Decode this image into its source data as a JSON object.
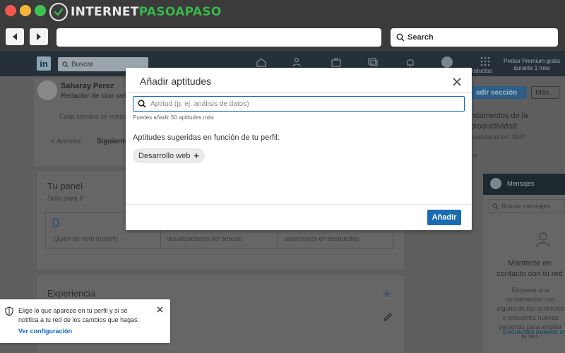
{
  "browser": {
    "brand_prefix": "INTERNET",
    "brand_accent": "PASOAPASO",
    "search_label": "Search"
  },
  "linkedin": {
    "search_placeholder": "Buscar",
    "premium_text": "Probar Premium gratis durante 1 mes",
    "products_label": "roductos",
    "profile": {
      "name": "Saharay Perez",
      "role": "Redactor de sitio web"
    },
    "background": {
      "weekly_text": "Cada semana se realiza",
      "prev_label": "< Anterior",
      "next_label": "Siguiente",
      "add_section_label": "adir sección",
      "more_label": "Más...",
      "article_title": "ndamentos de la productividad",
      "article_views": "sualizaciones: 9947",
      "article_more": "es",
      "panel_title": "Tu panel",
      "panel_subtitle": "Solo para ti",
      "panel_value": "0",
      "panel_stat_1": "Quién ha visto tu perfil",
      "panel_stat_2": "visualizaciones del artículo",
      "panel_stat_3": "apariciones en búsquedas",
      "experience_title": "Experiencia",
      "messages_title": "Mensajes",
      "messages_search": "Buscar mensajes",
      "network_title": "Mantente en contacto con tu red",
      "network_text": "Empieza una conversación con alguno de tus contactos o encuentra nuevas personas para ampliar tu red.",
      "network_link": "Encuentra nuevos contactos"
    }
  },
  "modal": {
    "title": "Añadir aptitudes",
    "input_placeholder": "Aptitud (p. ej. análisis de datos)",
    "hint": "Puedes añadir 50 aptitudes más",
    "suggest_label": "Aptitudes sugeridas en función de tu perfil:",
    "chips": [
      {
        "label": "Desarrollo web"
      }
    ],
    "add_button": "Añadir"
  },
  "toast": {
    "text": "Elige lo que aparece en tu perfil y si se notifica a tu red de los cambios que hagas.",
    "link": "Ver configuración"
  },
  "colors": {
    "accent_blue": "#0a66c2",
    "button_blue": "#1a6bb0",
    "brand_green": "#3ab54a"
  }
}
